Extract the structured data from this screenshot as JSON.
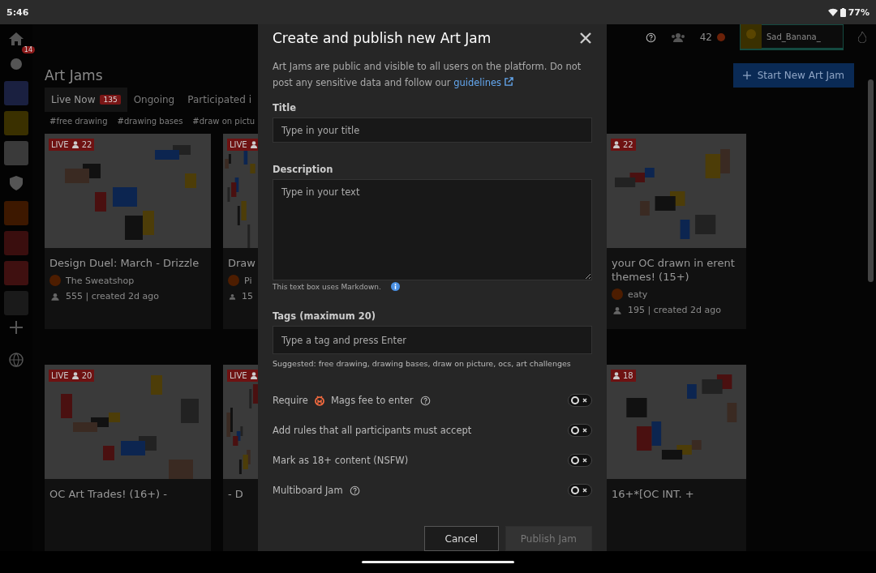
{
  "status_bar": {
    "time": "5:46",
    "battery": "77%"
  },
  "sidebar": {
    "badge": "14"
  },
  "header": {
    "coins": "42",
    "username": "Sad_Banana_"
  },
  "page": {
    "title": "Art Jams",
    "new_button": "Start New Art Jam",
    "tabs": [
      {
        "label": "Live Now",
        "badge": "135",
        "selected": true
      },
      {
        "label": "Ongoing",
        "selected": false
      },
      {
        "label": "Participated i",
        "selected": false
      }
    ],
    "tags": [
      "#free drawing",
      "#drawing bases",
      "#draw on pictu"
    ],
    "cards": [
      {
        "live_label": "LIVE",
        "count": "22",
        "title": "Design Duel: March - Drizzle",
        "author": "The Sweatshop",
        "stats": "555 | created 2d ago"
      },
      {
        "live_label": "LIVE",
        "title": "Draw",
        "author": "Pi",
        "stats": "15"
      },
      {
        "count": "22",
        "title": "your OC drawn in erent themes! (15+)",
        "author": "eaty",
        "stats": "195 | created 2d ago"
      },
      {
        "live_label": "LIVE",
        "count": "20",
        "title": "OC Art Trades! (16+) -"
      },
      {
        "live_label": "LIVE",
        "title": "- D"
      },
      {
        "count": "18",
        "title": "16+*[OC INT. +"
      }
    ]
  },
  "modal": {
    "title": "Create and publish new Art Jam",
    "intro": "Art Jams are public and visible to all users on the platform. Do not post any sensitive data and follow our",
    "link": "guidelines",
    "title_label": "Title",
    "title_placeholder": "Type in your title",
    "description_label": "Description",
    "description_placeholder": "Type in your text",
    "markdown_hint": "This text box uses Markdown.",
    "tags_label": "Tags (maximum 20)",
    "tags_placeholder": "Type a tag and press Enter",
    "suggested": "Suggested: free drawing, drawing bases, draw on picture, ocs, art challenges",
    "toggles": [
      {
        "kind": "fee",
        "label": "Require",
        "label_after": "Mags fee to enter",
        "help": true,
        "on": false
      },
      {
        "kind": "plain",
        "label": "Add rules that all participants must accept",
        "help": false,
        "on": false
      },
      {
        "kind": "plain",
        "label": "Mark as 18+ content (NSFW)",
        "help": false,
        "on": false
      },
      {
        "kind": "plain",
        "label": "Multiboard Jam",
        "help": true,
        "on": false
      }
    ],
    "buttons": [
      {
        "label": "Cancel",
        "disabled": false
      },
      {
        "label": "Publish Jam",
        "disabled": true
      }
    ]
  }
}
